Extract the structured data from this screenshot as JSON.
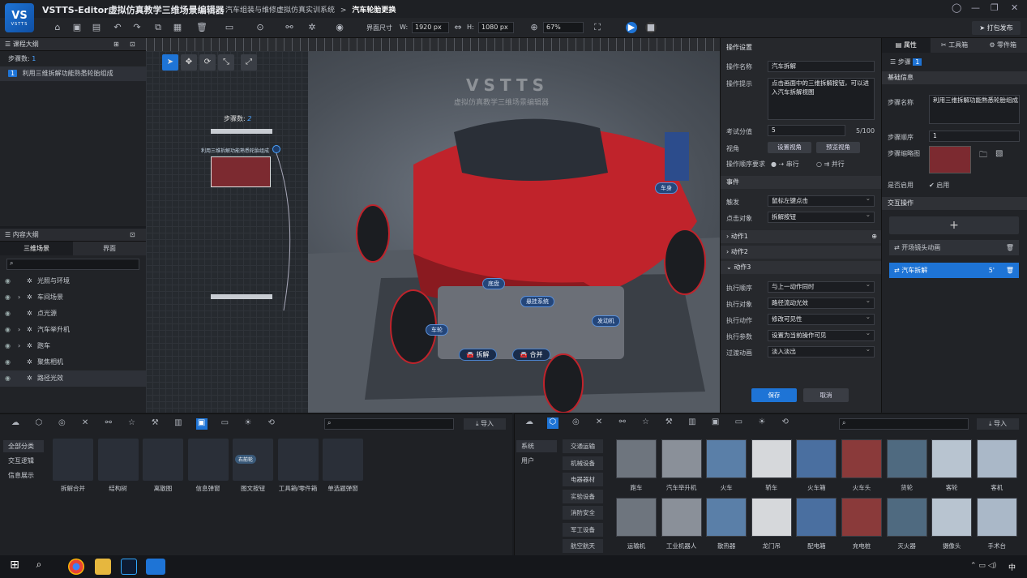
{
  "app": {
    "title": "VSTTS-Editor虚拟仿真教学三维场景编辑器",
    "logo_text": "VS",
    "logo_sub": "VSTTS",
    "breadcrumb": [
      "汽车组装与维修虚拟仿真实训系统",
      "汽车轮胎更换"
    ],
    "breadcrumb_sep": ">"
  },
  "toolbar": {
    "size_label": "界面尺寸",
    "w_label": "W:",
    "w_value": "1920 px",
    "h_label": "H:",
    "h_value": "1080 px",
    "zoom_value": "67%",
    "publish_label": "打包发布"
  },
  "outline": {
    "title": "课程大纲",
    "step_count_label": "步骤数:",
    "step_count": "1",
    "steps": [
      {
        "num": "1",
        "label": "利用三维拆解功能熟悉轮胎组成"
      }
    ]
  },
  "content": {
    "title": "内容大纲",
    "tabs": [
      "三维场景",
      "界面"
    ],
    "items": [
      {
        "label": "光照与环境",
        "expand": false
      },
      {
        "label": "车间场景",
        "expand": true
      },
      {
        "label": "点光源",
        "expand": false
      },
      {
        "label": "汽车举升机",
        "expand": true
      },
      {
        "label": "跑车",
        "expand": true
      },
      {
        "label": "聚焦相机",
        "expand": false
      },
      {
        "label": "路径光效",
        "expand": false
      }
    ]
  },
  "viewport": {
    "watermark": "VSTTS",
    "watermark_sub": "虚拟仿真教学三维场景编辑器",
    "step_count_label": "步骤数:",
    "step_count": "2",
    "flow_node": "利用三维拆解功能熟悉轮胎组成",
    "tags": [
      "车身",
      "底盘",
      "悬挂系统",
      "发动机",
      "车轮"
    ],
    "buttons": [
      "拆解",
      "合并"
    ]
  },
  "props": {
    "title": "操作设置",
    "name_label": "操作名称",
    "name_value": "汽车拆解",
    "hint_label": "操作提示",
    "hint_value": "点击画面中的三维拆解按钮，可以进入汽车拆解视图",
    "score_label": "考试分值",
    "score_value": "5",
    "score_total": "5/100",
    "view_label": "视角",
    "view_btn1": "设置视角",
    "view_btn2": "预览视角",
    "order_label": "操作顺序要求",
    "order_opt1": "串行",
    "order_opt2": "并行",
    "event_section": "事件",
    "trigger_label": "触发",
    "trigger_value": "鼠标左键点击",
    "target_label": "点击对象",
    "target_value": "拆解按钮",
    "action1": "动作1",
    "action2": "动作2",
    "action3": "动作3",
    "exec_order_label": "执行顺序",
    "exec_order_value": "与上一动作同时",
    "exec_target_label": "执行对象",
    "exec_target_value": "路径流动光效",
    "exec_action_label": "执行动作",
    "exec_action_value": "修改可见性",
    "exec_param_label": "执行参数",
    "exec_param_value": "设置为当前操作可见",
    "transition_label": "过渡动画",
    "transition_value": "淡入淡出",
    "save_label": "保存",
    "cancel_label": "取消"
  },
  "right": {
    "tabs": [
      "属性",
      "工具箱",
      "零件箱"
    ],
    "step_label": "步骤",
    "step_num": "1",
    "basic_section": "基础信息",
    "step_name_label": "步骤名称",
    "step_name_value": "利用三维拆解功能熟悉轮胎组成",
    "step_order_label": "步骤顺序",
    "step_order_value": "1",
    "thumb_label": "步骤缩略图",
    "enable_label": "是否启用",
    "enable_value": "启用",
    "interact_section": "交互操作",
    "ops": [
      {
        "label": "开场镜头动画",
        "score": ""
      },
      {
        "label": "汽车拆解",
        "score": "5'"
      }
    ]
  },
  "bottom_left": {
    "import_label": "导入",
    "categories": [
      "全部分类",
      "交互逻辑",
      "信息展示"
    ],
    "widgets": [
      "拆解合并",
      "结构树",
      "离散图",
      "信息弹窗",
      "图文按钮",
      "工具箱/零件箱",
      "单选题弹窗"
    ],
    "button_text": "右前轮"
  },
  "bottom_right": {
    "import_label": "导入",
    "categories": [
      "系统",
      "用户"
    ],
    "subcategories": [
      "交通运输",
      "机械设备",
      "电器器材",
      "实验设备",
      "消防安全",
      "军工设备",
      "航空航天"
    ],
    "assets": [
      "跑车",
      "汽车举升机",
      "火车",
      "轿车",
      "火车箱",
      "火车头",
      "货轮",
      "客轮",
      "客机",
      "运输机",
      "工业机器人",
      "散热器",
      "龙门吊",
      "配电箱",
      "充电桩",
      "灭火器",
      "摄像头",
      "手术台"
    ]
  },
  "taskbar": {
    "ime": "中"
  }
}
